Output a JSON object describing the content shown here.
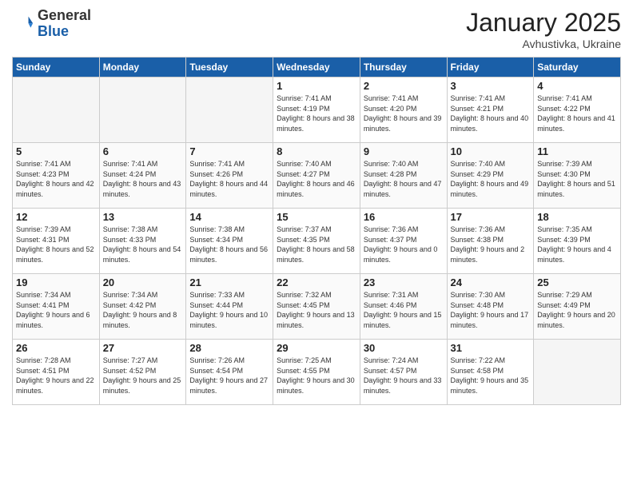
{
  "header": {
    "logo_general": "General",
    "logo_blue": "Blue",
    "month_year": "January 2025",
    "location": "Avhustivka, Ukraine"
  },
  "weekdays": [
    "Sunday",
    "Monday",
    "Tuesday",
    "Wednesday",
    "Thursday",
    "Friday",
    "Saturday"
  ],
  "weeks": [
    [
      {
        "day": "",
        "info": ""
      },
      {
        "day": "",
        "info": ""
      },
      {
        "day": "",
        "info": ""
      },
      {
        "day": "1",
        "info": "Sunrise: 7:41 AM\nSunset: 4:19 PM\nDaylight: 8 hours and 38 minutes."
      },
      {
        "day": "2",
        "info": "Sunrise: 7:41 AM\nSunset: 4:20 PM\nDaylight: 8 hours and 39 minutes."
      },
      {
        "day": "3",
        "info": "Sunrise: 7:41 AM\nSunset: 4:21 PM\nDaylight: 8 hours and 40 minutes."
      },
      {
        "day": "4",
        "info": "Sunrise: 7:41 AM\nSunset: 4:22 PM\nDaylight: 8 hours and 41 minutes."
      }
    ],
    [
      {
        "day": "5",
        "info": "Sunrise: 7:41 AM\nSunset: 4:23 PM\nDaylight: 8 hours and 42 minutes."
      },
      {
        "day": "6",
        "info": "Sunrise: 7:41 AM\nSunset: 4:24 PM\nDaylight: 8 hours and 43 minutes."
      },
      {
        "day": "7",
        "info": "Sunrise: 7:41 AM\nSunset: 4:26 PM\nDaylight: 8 hours and 44 minutes."
      },
      {
        "day": "8",
        "info": "Sunrise: 7:40 AM\nSunset: 4:27 PM\nDaylight: 8 hours and 46 minutes."
      },
      {
        "day": "9",
        "info": "Sunrise: 7:40 AM\nSunset: 4:28 PM\nDaylight: 8 hours and 47 minutes."
      },
      {
        "day": "10",
        "info": "Sunrise: 7:40 AM\nSunset: 4:29 PM\nDaylight: 8 hours and 49 minutes."
      },
      {
        "day": "11",
        "info": "Sunrise: 7:39 AM\nSunset: 4:30 PM\nDaylight: 8 hours and 51 minutes."
      }
    ],
    [
      {
        "day": "12",
        "info": "Sunrise: 7:39 AM\nSunset: 4:31 PM\nDaylight: 8 hours and 52 minutes."
      },
      {
        "day": "13",
        "info": "Sunrise: 7:38 AM\nSunset: 4:33 PM\nDaylight: 8 hours and 54 minutes."
      },
      {
        "day": "14",
        "info": "Sunrise: 7:38 AM\nSunset: 4:34 PM\nDaylight: 8 hours and 56 minutes."
      },
      {
        "day": "15",
        "info": "Sunrise: 7:37 AM\nSunset: 4:35 PM\nDaylight: 8 hours and 58 minutes."
      },
      {
        "day": "16",
        "info": "Sunrise: 7:36 AM\nSunset: 4:37 PM\nDaylight: 9 hours and 0 minutes."
      },
      {
        "day": "17",
        "info": "Sunrise: 7:36 AM\nSunset: 4:38 PM\nDaylight: 9 hours and 2 minutes."
      },
      {
        "day": "18",
        "info": "Sunrise: 7:35 AM\nSunset: 4:39 PM\nDaylight: 9 hours and 4 minutes."
      }
    ],
    [
      {
        "day": "19",
        "info": "Sunrise: 7:34 AM\nSunset: 4:41 PM\nDaylight: 9 hours and 6 minutes."
      },
      {
        "day": "20",
        "info": "Sunrise: 7:34 AM\nSunset: 4:42 PM\nDaylight: 9 hours and 8 minutes."
      },
      {
        "day": "21",
        "info": "Sunrise: 7:33 AM\nSunset: 4:44 PM\nDaylight: 9 hours and 10 minutes."
      },
      {
        "day": "22",
        "info": "Sunrise: 7:32 AM\nSunset: 4:45 PM\nDaylight: 9 hours and 13 minutes."
      },
      {
        "day": "23",
        "info": "Sunrise: 7:31 AM\nSunset: 4:46 PM\nDaylight: 9 hours and 15 minutes."
      },
      {
        "day": "24",
        "info": "Sunrise: 7:30 AM\nSunset: 4:48 PM\nDaylight: 9 hours and 17 minutes."
      },
      {
        "day": "25",
        "info": "Sunrise: 7:29 AM\nSunset: 4:49 PM\nDaylight: 9 hours and 20 minutes."
      }
    ],
    [
      {
        "day": "26",
        "info": "Sunrise: 7:28 AM\nSunset: 4:51 PM\nDaylight: 9 hours and 22 minutes."
      },
      {
        "day": "27",
        "info": "Sunrise: 7:27 AM\nSunset: 4:52 PM\nDaylight: 9 hours and 25 minutes."
      },
      {
        "day": "28",
        "info": "Sunrise: 7:26 AM\nSunset: 4:54 PM\nDaylight: 9 hours and 27 minutes."
      },
      {
        "day": "29",
        "info": "Sunrise: 7:25 AM\nSunset: 4:55 PM\nDaylight: 9 hours and 30 minutes."
      },
      {
        "day": "30",
        "info": "Sunrise: 7:24 AM\nSunset: 4:57 PM\nDaylight: 9 hours and 33 minutes."
      },
      {
        "day": "31",
        "info": "Sunrise: 7:22 AM\nSunset: 4:58 PM\nDaylight: 9 hours and 35 minutes."
      },
      {
        "day": "",
        "info": ""
      }
    ]
  ]
}
